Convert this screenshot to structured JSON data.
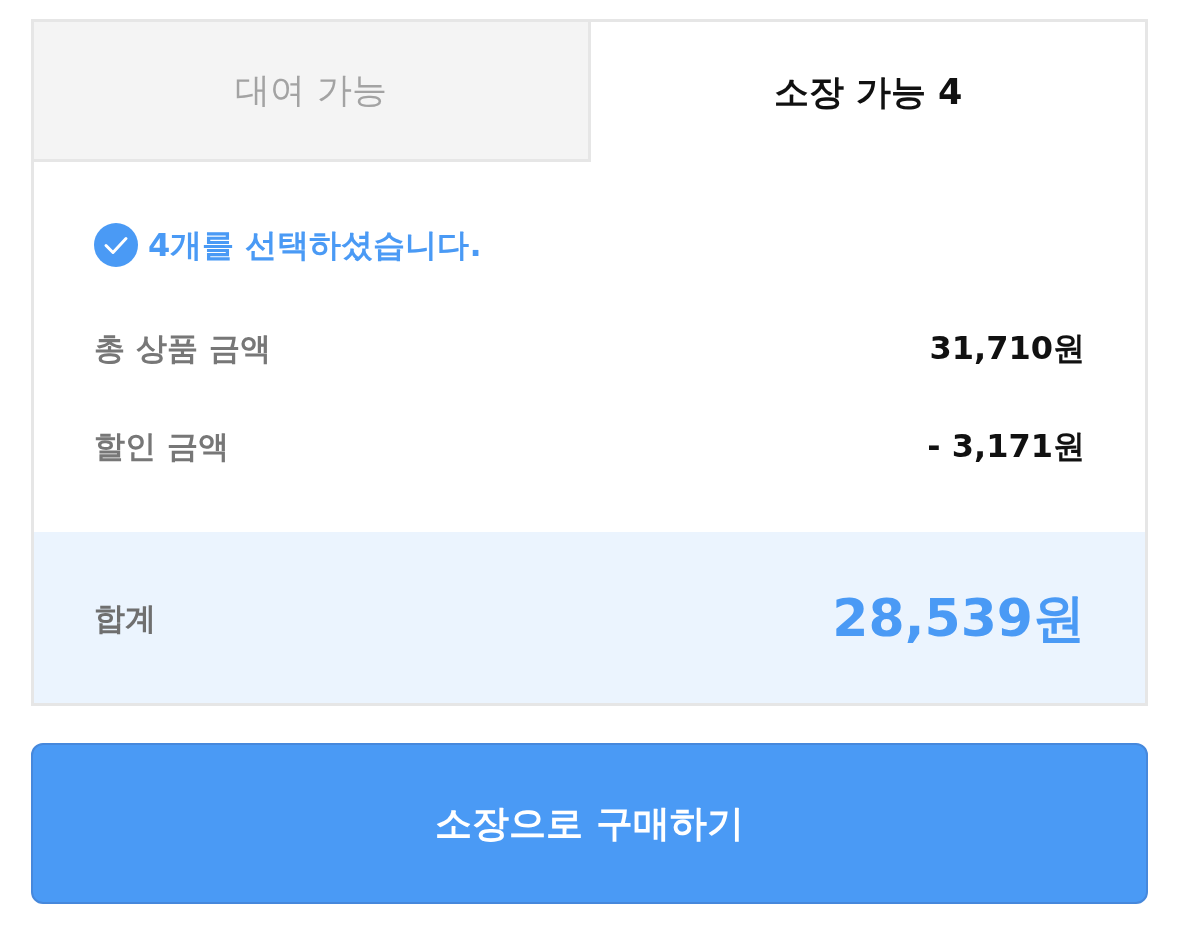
{
  "tabs": [
    {
      "label": "대여 가능",
      "selected": false
    },
    {
      "label": "소장 가능 4",
      "selected": true
    }
  ],
  "selection_notice": {
    "text": "4개를 선택하셨습니다."
  },
  "price_rows": [
    {
      "label": "총 상품 금액",
      "value": "31,710원"
    },
    {
      "label": "할인 금액",
      "value": "- 3,171원"
    }
  ],
  "total": {
    "label": "합계",
    "value": "28,539원"
  },
  "buy_button": {
    "label": "소장으로 구매하기"
  }
}
